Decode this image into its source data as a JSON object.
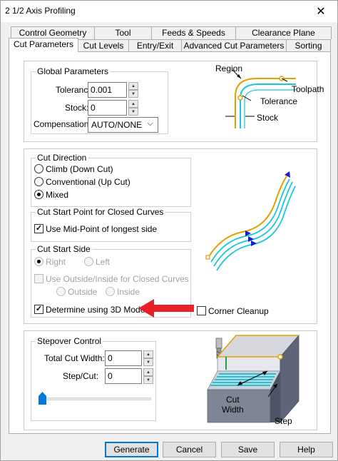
{
  "window": {
    "title": "2 1/2 Axis Profiling",
    "close_glyph": "✕"
  },
  "tabs_row1": [
    {
      "label": "Control Geometry"
    },
    {
      "label": "Tool"
    },
    {
      "label": "Feeds & Speeds"
    },
    {
      "label": "Clearance Plane"
    }
  ],
  "tabs_row2": [
    {
      "label": "Cut Parameters",
      "active": true
    },
    {
      "label": "Cut Levels"
    },
    {
      "label": "Entry/Exit"
    },
    {
      "label": "Advanced Cut Parameters"
    },
    {
      "label": "Sorting"
    }
  ],
  "global_parameters": {
    "title": "Global Parameters",
    "tolerance_label": "Tolerance:",
    "tolerance_value": "0.001",
    "stock_label": "Stock:",
    "stock_value": "0",
    "compensation_label": "Compensation:",
    "compensation_value": "AUTO/NONE"
  },
  "diagram1": {
    "region": "Region",
    "toolpath": "Toolpath",
    "tolerance": "Tolerance",
    "stock": "Stock"
  },
  "cut_direction": {
    "title": "Cut Direction",
    "options": [
      {
        "label": "Climb (Down Cut)",
        "checked": false
      },
      {
        "label": "Conventional (Up Cut)",
        "checked": false
      },
      {
        "label": "Mixed",
        "checked": true
      }
    ]
  },
  "cut_start_point": {
    "title": "Cut Start Point for Closed Curves",
    "midpoint_label": "Use Mid-Point of longest side",
    "midpoint_checked": true
  },
  "cut_start_side": {
    "title": "Cut Start Side",
    "right": "Right",
    "left": "Left",
    "use_outside_inside": "Use Outside/Inside for Closed Curves",
    "outside": "Outside",
    "inside": "Inside",
    "determine_3d": "Determine using 3D Model",
    "determine_3d_checked": true
  },
  "corner_cleanup": {
    "label": "Corner Cleanup",
    "checked": false
  },
  "stepover": {
    "title": "Stepover Control",
    "total_cut_width_label": "Total Cut Width:",
    "total_cut_width_value": "0",
    "step_cut_label": "Step/Cut:",
    "step_cut_value": "0",
    "slider_fraction": 0.0
  },
  "diagram3": {
    "cut_width": "Cut\nWidth",
    "cut": "Cut",
    "width": "Width",
    "step": "Step"
  },
  "buttons": {
    "generate": "Generate",
    "cancel": "Cancel",
    "save": "Save",
    "help": "Help"
  },
  "colors": {
    "region_orange": "#e0a000",
    "toolpath_cyan": "#19c6dc",
    "arrow_red": "#e8202a",
    "direction_blue": "#1c1cc8",
    "accent_default": "#0078d7"
  }
}
